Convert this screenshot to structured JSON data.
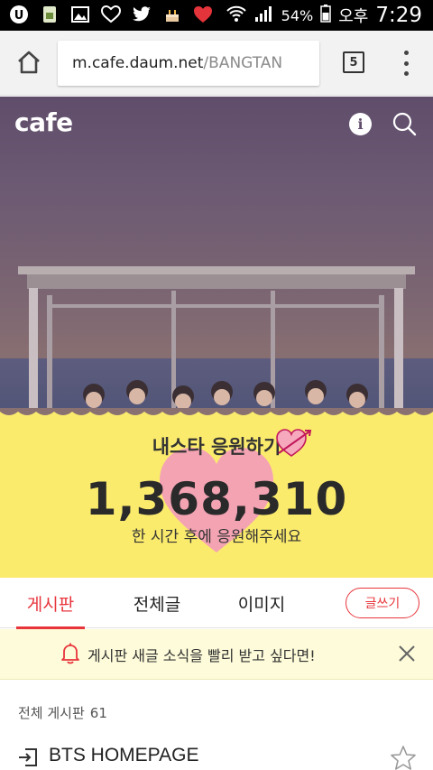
{
  "status_bar": {
    "battery_percent": "54%",
    "ampm": "오후",
    "time": "7:29"
  },
  "browser": {
    "url_host": "m.cafe.daum.net",
    "url_path": "/BANGTAN",
    "tab_count": "5"
  },
  "header": {
    "logo": "cafe"
  },
  "banner": {
    "title": "내스타 응원하기",
    "count": "1,368,310",
    "subtitle": "한 시간 후에 응원해주세요"
  },
  "tabs": [
    {
      "label": "게시판",
      "active": true
    },
    {
      "label": "전체글",
      "active": false
    },
    {
      "label": "이미지",
      "active": false
    }
  ],
  "write_button": "글쓰기",
  "notice": {
    "text": "게시판 새글 소식을 빨리 받고 싶다면!"
  },
  "section": {
    "label": "전체 게시판",
    "count": "61"
  },
  "list": [
    {
      "label": "BTS HOMEPAGE"
    }
  ],
  "colors": {
    "accent": "#e8353c",
    "banner_bg": "#fbeb6d",
    "heart": "#f4a3b3",
    "notice_bg": "#fdfbd9"
  }
}
